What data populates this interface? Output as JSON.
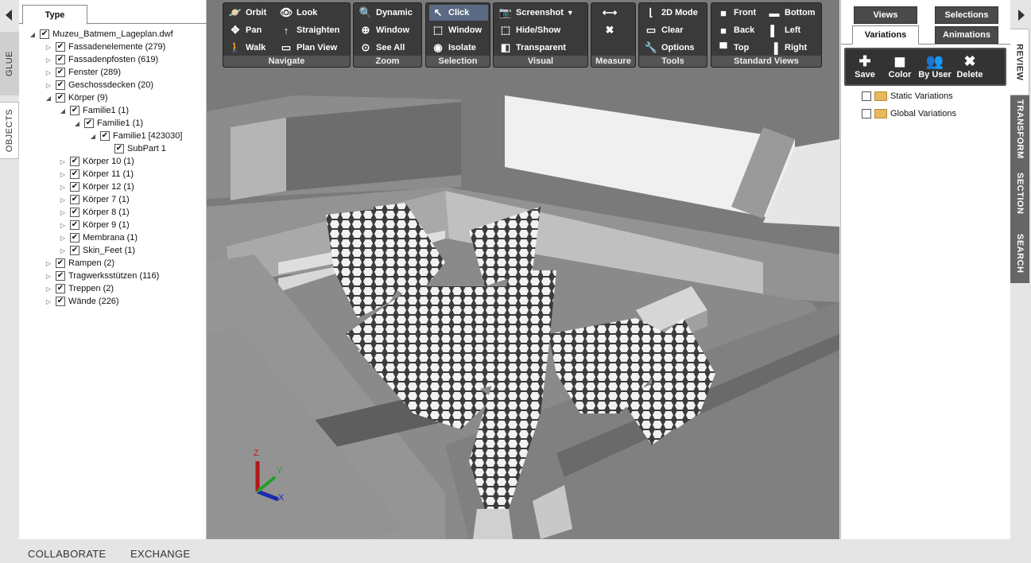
{
  "left_tabs": {
    "glue": "GLUE",
    "objects": "OBJECTS"
  },
  "tree": {
    "tab_label": "Type",
    "items": [
      {
        "label": "Muzeu_Batmem_Lageplan.dwf",
        "level": 0,
        "exp": "◢",
        "checked": true
      },
      {
        "label": "Fassadenelemente (279)",
        "level": 1,
        "exp": "▷",
        "checked": true
      },
      {
        "label": "Fassadenpfosten (619)",
        "level": 1,
        "exp": "▷",
        "checked": true
      },
      {
        "label": "Fenster (289)",
        "level": 1,
        "exp": "▷",
        "checked": true
      },
      {
        "label": "Geschossdecken (20)",
        "level": 1,
        "exp": "▷",
        "checked": true
      },
      {
        "label": "Körper (9)",
        "level": 1,
        "exp": "◢",
        "checked": true
      },
      {
        "label": "Familie1 (1)",
        "level": 2,
        "exp": "◢",
        "checked": true
      },
      {
        "label": "Familie1 (1)",
        "level": 3,
        "exp": "◢",
        "checked": true
      },
      {
        "label": "Familie1 [423030]",
        "level": 4,
        "exp": "◢",
        "checked": true
      },
      {
        "label": "SubPart 1",
        "level": 5,
        "exp": "",
        "checked": true
      },
      {
        "label": "Körper 10 (1)",
        "level": 2,
        "exp": "▷",
        "checked": true
      },
      {
        "label": "Körper 11 (1)",
        "level": 2,
        "exp": "▷",
        "checked": true
      },
      {
        "label": "Körper 12 (1)",
        "level": 2,
        "exp": "▷",
        "checked": true
      },
      {
        "label": "Körper 7 (1)",
        "level": 2,
        "exp": "▷",
        "checked": true
      },
      {
        "label": "Körper 8 (1)",
        "level": 2,
        "exp": "▷",
        "checked": true
      },
      {
        "label": "Körper 9 (1)",
        "level": 2,
        "exp": "▷",
        "checked": true
      },
      {
        "label": "Membrana (1)",
        "level": 2,
        "exp": "▷",
        "checked": true
      },
      {
        "label": "Skin_Feet (1)",
        "level": 2,
        "exp": "▷",
        "checked": true
      },
      {
        "label": "Rampen (2)",
        "level": 1,
        "exp": "▷",
        "checked": true
      },
      {
        "label": "Tragwerksstützen (116)",
        "level": 1,
        "exp": "▷",
        "checked": true
      },
      {
        "label": "Treppen (2)",
        "level": 1,
        "exp": "▷",
        "checked": true
      },
      {
        "label": "Wände (226)",
        "level": 1,
        "exp": "▷",
        "checked": true
      }
    ]
  },
  "toolbar": {
    "navigate": {
      "label": "Navigate",
      "orbit": "Orbit",
      "look": "Look",
      "pan": "Pan",
      "straighten": "Straighten",
      "walk": "Walk",
      "plan_view": "Plan View"
    },
    "zoom": {
      "label": "Zoom",
      "dynamic": "Dynamic",
      "window": "Window",
      "see_all": "See All"
    },
    "selection": {
      "label": "Selection",
      "click": "Click",
      "window": "Window",
      "isolate": "Isolate"
    },
    "visual": {
      "label": "Visual",
      "screenshot": "Screenshot",
      "hide_show": "Hide/Show",
      "transparent": "Transparent"
    },
    "measure": {
      "label": "Measure"
    },
    "tools": {
      "label": "Tools",
      "mode_2d": "2D Mode",
      "clear": "Clear",
      "options": "Options"
    },
    "standard_views": {
      "label": "Standard Views",
      "front": "Front",
      "bottom": "Bottom",
      "back": "Back",
      "left": "Left",
      "top": "Top",
      "right": "Right"
    }
  },
  "axis_triad": {
    "z": "Z",
    "y": "Y",
    "x": "X"
  },
  "right_panel": {
    "tabs": {
      "views": "Views",
      "selections": "Selections",
      "variations": "Variations",
      "animations": "Animations"
    },
    "variation_tools": {
      "save": "Save",
      "color": "Color",
      "by_user": "By User",
      "delete": "Delete"
    },
    "items": [
      "Static Variations",
      "Global Variations"
    ]
  },
  "right_tabs": {
    "review": "REVIEW",
    "transform": "TRANSFORM",
    "section": "SECTION",
    "search": "SEARCH"
  },
  "bottom_tabs": {
    "collaborate": "COLLABORATE",
    "exchange": "EXCHANGE"
  }
}
